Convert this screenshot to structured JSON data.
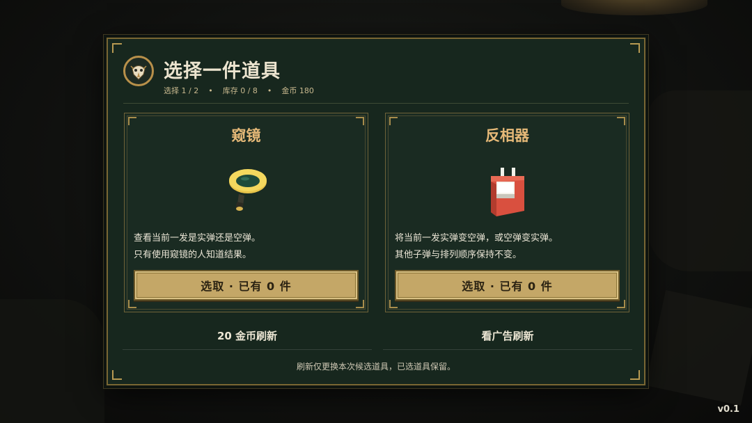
{
  "header": {
    "title": "选择一件道具",
    "emblem_icon": "raven-skull-icon",
    "stats": {
      "select": "选择 1 / 2",
      "inventory": "库存 0 / 8",
      "gold": "金币 180"
    }
  },
  "items": [
    {
      "name": "窥镜",
      "icon": "magnifying-glass-icon",
      "desc_line1": "查看当前一发是实弹还是空弹。",
      "desc_line2": "只有使用窥镜的人知道结果。",
      "button_label": "选取 · 已有 0 件"
    },
    {
      "name": "反相器",
      "icon": "inverter-device-icon",
      "desc_line1": "将当前一发实弹变空弹，或空弹变实弹。",
      "desc_line2": "其他子弹与排列顺序保持不变。",
      "button_label": "选取 · 已有 0 件"
    }
  ],
  "refresh": {
    "gold_label": "20 金币刷新",
    "ad_label": "看广告刷新",
    "note": "刷新仅更换本次候选道具，已选道具保留。"
  },
  "version": "v0.1",
  "colors": {
    "panel_bg": "#17271e",
    "gold_border": "#b89a52",
    "item_title": "#e6b978",
    "button_bg": "#c4a767"
  }
}
